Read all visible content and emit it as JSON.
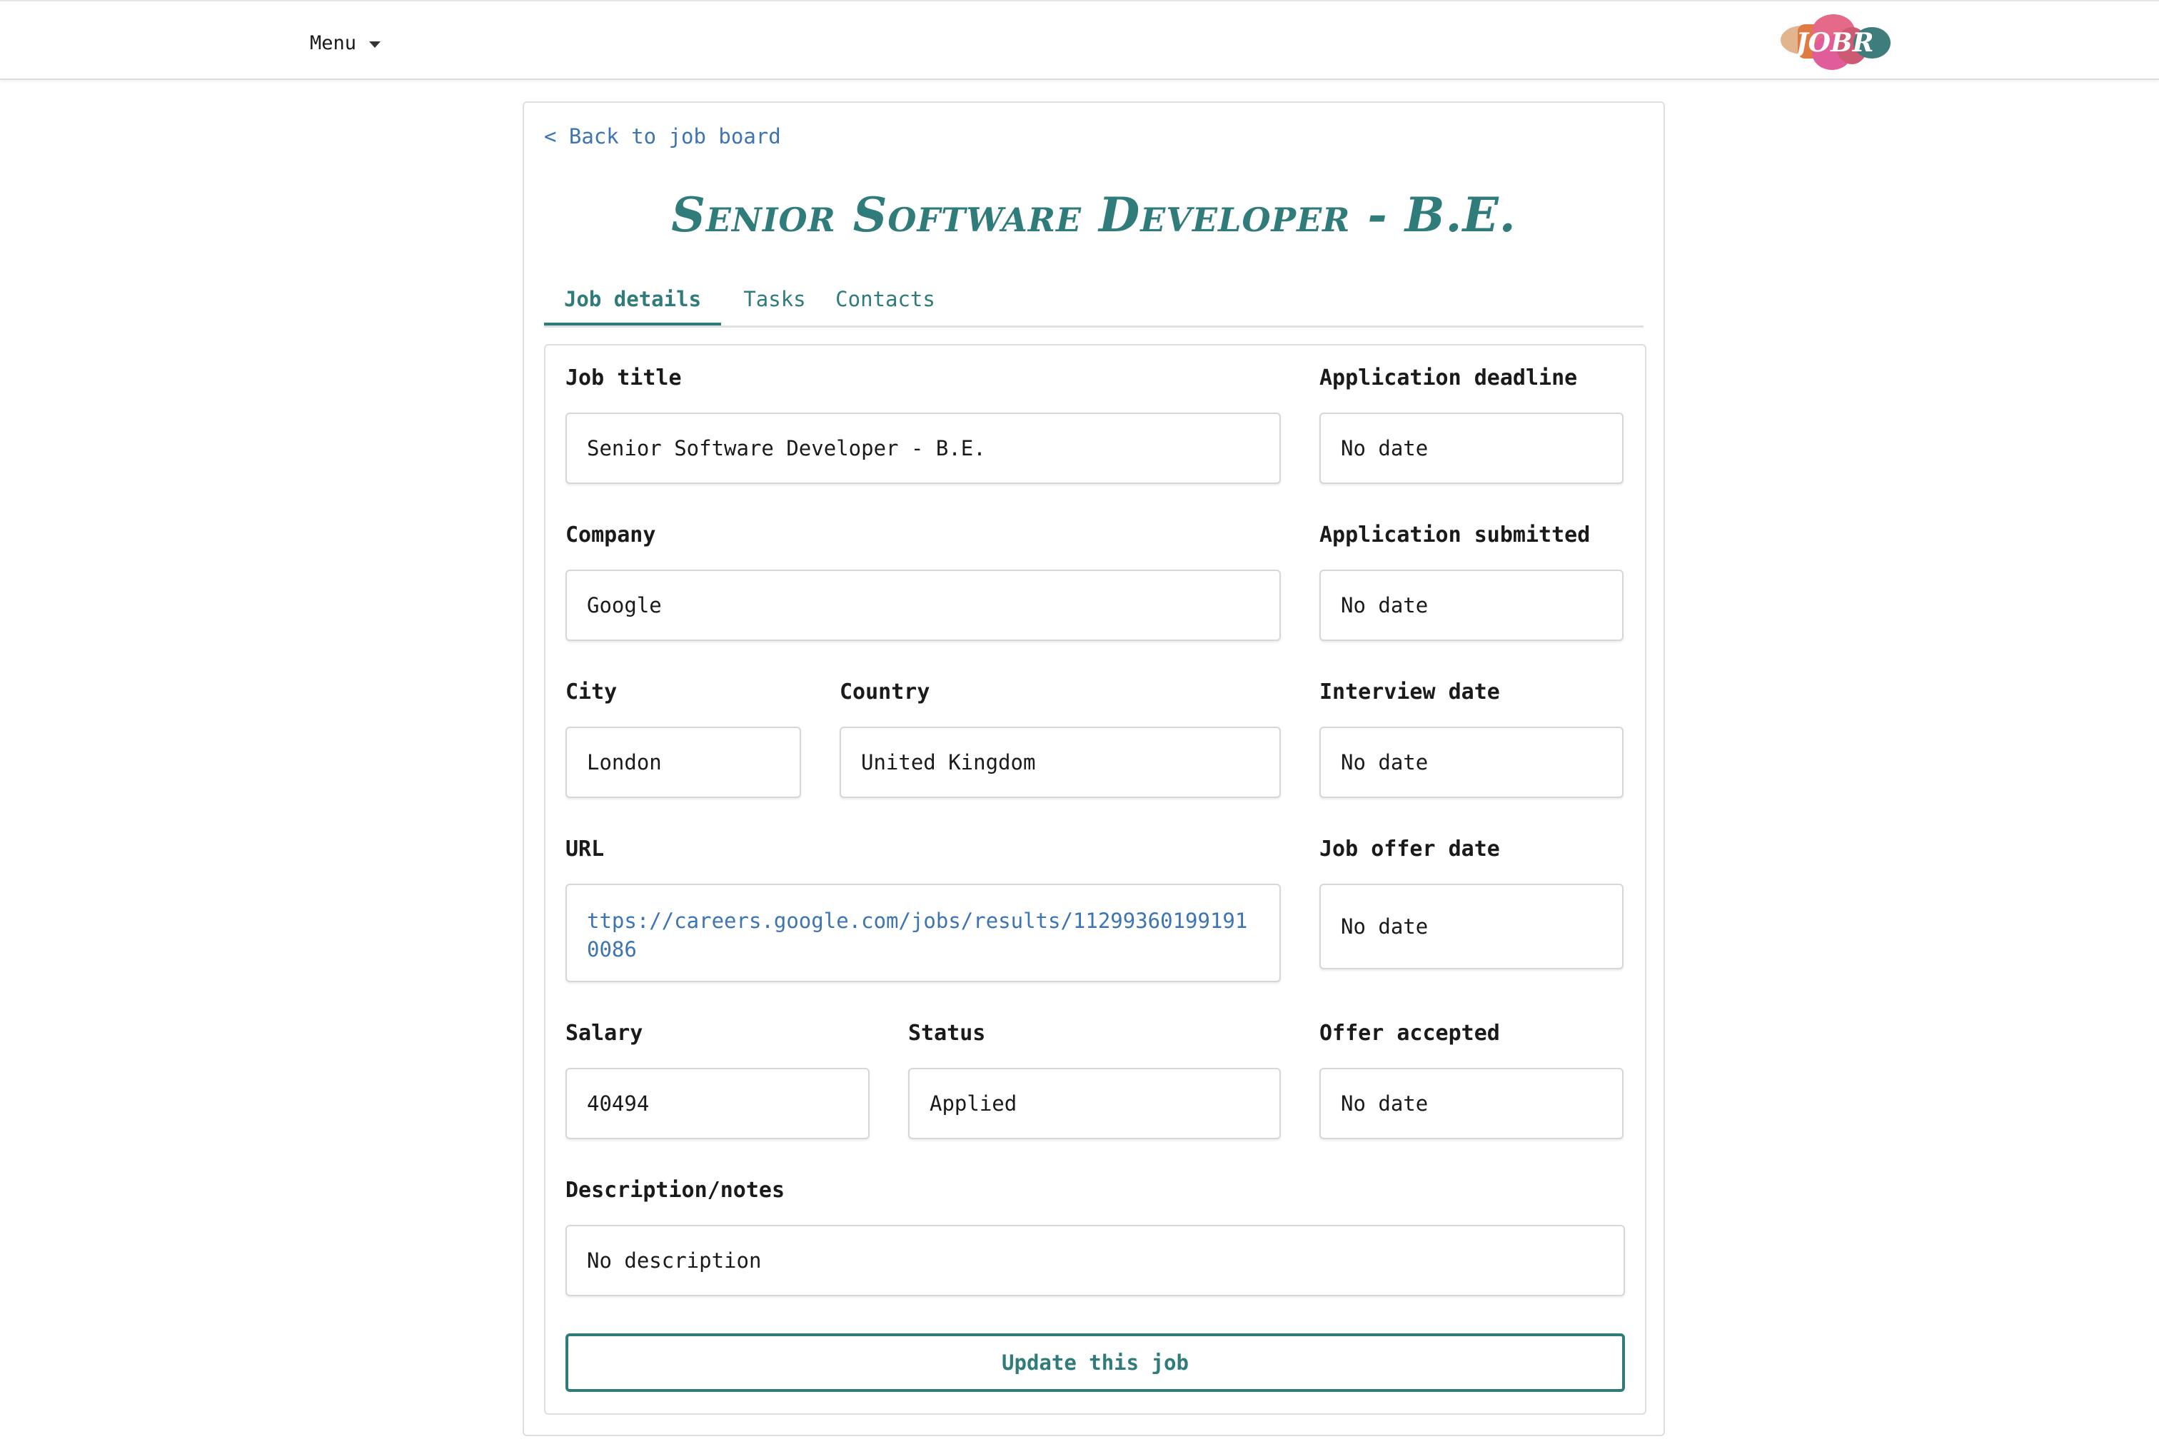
{
  "header": {
    "menu_label": "Menu",
    "logo_text": "JOBR",
    "logo_colors": [
      "#e2b58f",
      "#df7a42",
      "#e05c9a",
      "#e56a8a",
      "#cc5a72",
      "#3e7d7b"
    ]
  },
  "page": {
    "back_label": "< Back to job board",
    "title": "Senior Software Developer - B.E."
  },
  "tabs": [
    {
      "label": "Job details",
      "active": true
    },
    {
      "label": "Tasks",
      "active": false
    },
    {
      "label": "Contacts",
      "active": false
    }
  ],
  "form": {
    "job_title": {
      "label": "Job title",
      "value": "Senior Software Developer - B.E."
    },
    "company": {
      "label": "Company",
      "value": "Google"
    },
    "city": {
      "label": "City",
      "value": "London"
    },
    "country": {
      "label": "Country",
      "value": "United Kingdom"
    },
    "url": {
      "label": "URL",
      "value": "ttps://careers.google.com/jobs/results/112993601991910086"
    },
    "salary": {
      "label": "Salary",
      "value": "40494"
    },
    "status": {
      "label": "Status",
      "value": "Applied"
    },
    "description": {
      "label": "Description/notes",
      "value": "No description"
    },
    "application_deadline": {
      "label": "Application deadline",
      "value": "No date"
    },
    "application_submitted": {
      "label": "Application submitted",
      "value": "No date"
    },
    "interview_date": {
      "label": "Interview date",
      "value": "No date"
    },
    "job_offer_date": {
      "label": "Job offer date",
      "value": "No date"
    },
    "offer_accepted": {
      "label": "Offer accepted",
      "value": "No date"
    },
    "submit_label": "Update this job"
  },
  "colors": {
    "accent": "#2f7c7a",
    "link": "#3d74b3"
  }
}
